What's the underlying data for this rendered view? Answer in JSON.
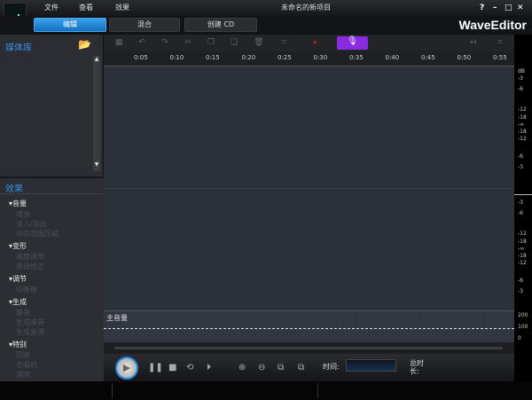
{
  "titlebar": {
    "menus": [
      "文件",
      "查看",
      "效果"
    ],
    "title": "未命名的新项目",
    "help": "?",
    "minimize": "–",
    "maximize": "□",
    "close": "✕"
  },
  "tabs": [
    "编辑",
    "混合",
    "创建 CD"
  ],
  "brand": "WaveEditor",
  "media_library": {
    "title": "媒体库"
  },
  "effects": {
    "title": "效果",
    "groups": [
      {
        "label": "音量",
        "items": [
          "增益",
          "淡入/淡出",
          "动态范围压缩"
        ]
      },
      {
        "label": "变形",
        "items": [
          "速度调节",
          "音调修正"
        ]
      },
      {
        "label": "调节",
        "items": [
          "均衡器"
        ]
      },
      {
        "label": "生成",
        "items": [
          "静音",
          "生成噪音",
          "生成音调"
        ]
      },
      {
        "label": "特别",
        "items": [
          "回音",
          "合唱机",
          "混响"
        ]
      }
    ]
  },
  "ruler": {
    "ticks": [
      "0:05",
      "0:10",
      "0:15",
      "0:20",
      "0:25",
      "0:30",
      "0:35",
      "0:40",
      "0:45",
      "0:50",
      "0:55"
    ]
  },
  "meter": {
    "unit": "dB",
    "labels_top": [
      "-3",
      "-6",
      "-12",
      "-18",
      "-∞",
      "-18",
      "-12",
      "-6",
      "-3"
    ],
    "labels_bottom": [
      "-3",
      "-6",
      "-12",
      "-18",
      "-∞",
      "-18",
      "-12",
      "-6",
      "-3"
    ],
    "volume_scale": [
      "200",
      "100",
      "0"
    ]
  },
  "volume_track": {
    "label": "主音量",
    "level": 100
  },
  "transport": {
    "time_label": "时间:",
    "total_label": "总时长:",
    "time_value": ""
  },
  "colors": {
    "accent": "#1e88d8",
    "record": "#8a2be2"
  }
}
